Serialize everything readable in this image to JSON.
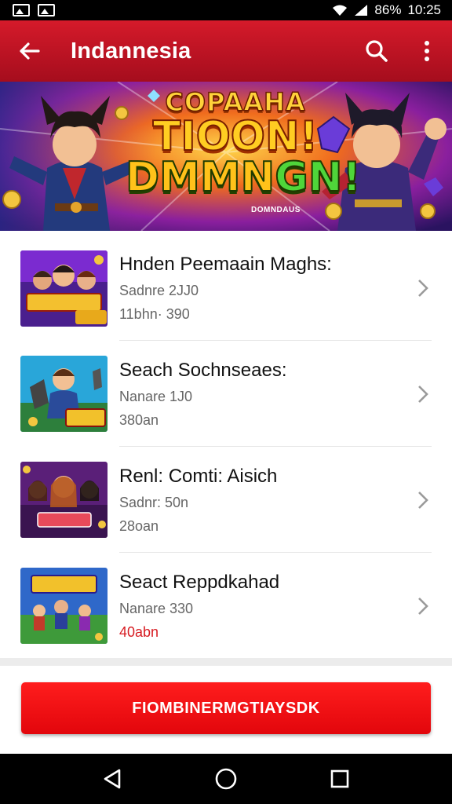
{
  "status_bar": {
    "battery": "86%",
    "time": "10:25",
    "icons": [
      "image-icon",
      "gallery-icon",
      "wifi-icon",
      "signal-icon"
    ]
  },
  "app_bar": {
    "title": "Indannesia",
    "back_icon": "arrow-left-icon",
    "search_icon": "search-icon",
    "menu_icon": "more-vert-icon",
    "color": "#c8142a"
  },
  "banner": {
    "line1": "COPAAHA",
    "line2": "TIOON!",
    "line3_a": "DMMN",
    "line3_b": "GN!",
    "subtitle": "DOMNDAUS"
  },
  "list": [
    {
      "title": "Hnden Peemaain Maghs:",
      "meta1": "Sadnre 2JJ0",
      "meta2": "11bhn· 390",
      "meta2_red": false
    },
    {
      "title": "Seach Sochnseaes:",
      "meta1": "Nanare 1J0",
      "meta2": "380an",
      "meta2_red": false
    },
    {
      "title": "Renl: Comti: Aisich",
      "meta1": "Sadnr: 50n",
      "meta2": "28oan",
      "meta2_red": false
    },
    {
      "title": "Seact Reppdkahad",
      "meta1": "Nanare 330",
      "meta2": "40abn",
      "meta2_red": true
    }
  ],
  "cta": {
    "label": "FIOMBINERMGTIAYSDK",
    "color": "#e8090f"
  },
  "nav": {
    "back_icon": "nav-back-icon",
    "home_icon": "nav-home-icon",
    "recents_icon": "nav-recents-icon"
  }
}
